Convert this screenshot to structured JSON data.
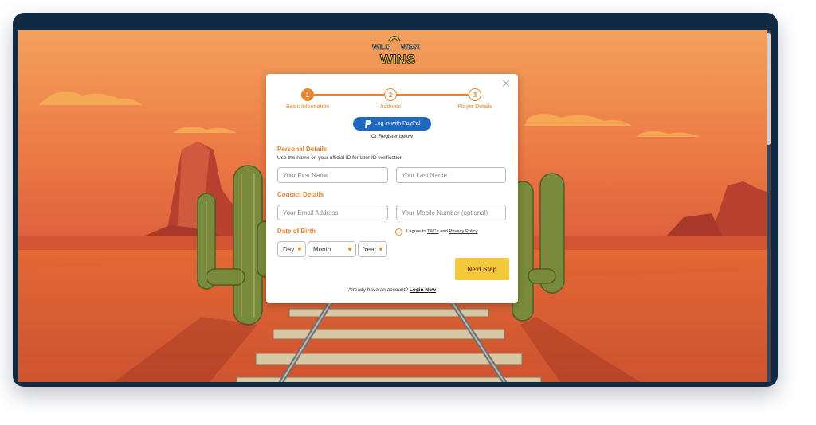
{
  "brand": {
    "logo_line1": "WILD WEST",
    "logo_line2": "WINS"
  },
  "stepper": {
    "steps": [
      {
        "number": "1",
        "label": "Basic Information",
        "state": "active"
      },
      {
        "number": "2",
        "label": "Address",
        "state": "todo"
      },
      {
        "number": "3",
        "label": "Player Details",
        "state": "todo"
      }
    ]
  },
  "paypal": {
    "label": "Log in with PayPal",
    "or_register": "Or Register below"
  },
  "personal": {
    "title": "Personal Details",
    "hint": "Use the name on your official ID for later ID verification",
    "first_name_placeholder": "Your First Name",
    "last_name_placeholder": "Your Last Name"
  },
  "contact": {
    "title": "Contact Details",
    "email_placeholder": "Your Email Address",
    "mobile_placeholder": "Your Mobile Number (optional)"
  },
  "dob": {
    "title": "Date of Birth",
    "day": "Day",
    "month": "Month",
    "year": "Year"
  },
  "agree": {
    "prefix": "I agree to",
    "tcs": "T&Cs",
    "and": "and",
    "privacy": "Privacy Policy"
  },
  "actions": {
    "next_step": "Next Step",
    "already": "Already have an account?",
    "login_now": "Login Now"
  },
  "colors": {
    "accent": "#e8852e",
    "paypal": "#1f67c0",
    "next_button": "#f3c93a",
    "frame": "#102a43"
  },
  "icons": {
    "close": "close-icon",
    "paypal": "paypal-icon",
    "select_caret": "chevron-down-icon"
  }
}
